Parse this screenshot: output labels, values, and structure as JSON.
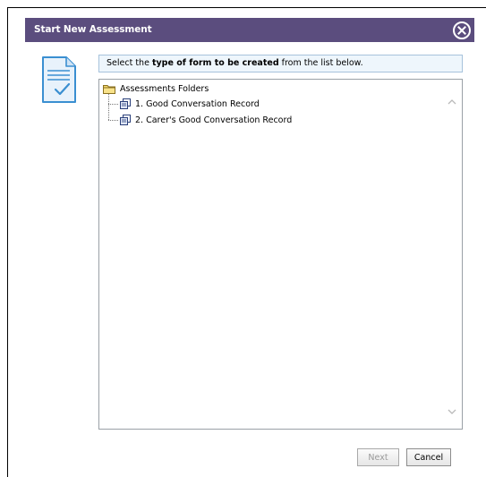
{
  "dialog": {
    "title": "Start New Assessment",
    "close_icon": "close-circle-icon",
    "doc_icon": "document-check-icon"
  },
  "instruction": {
    "prefix": "Select the ",
    "bold": "type of form to be created",
    "suffix": " from the list below."
  },
  "tree": {
    "root": {
      "label": "Assessments Folders",
      "icon": "folder-icon"
    },
    "items": [
      {
        "label": "1. Good Conversation Record",
        "icon": "form-icon"
      },
      {
        "label": "2. Carer's Good Conversation Record",
        "icon": "form-icon"
      }
    ]
  },
  "buttons": {
    "next": "Next",
    "cancel": "Cancel"
  },
  "colors": {
    "titlebar": "#5b4d7e",
    "instruction_bg": "#eef6fc",
    "instruction_border": "#a7c3dc",
    "icon_blue": "#3a8fd1"
  }
}
